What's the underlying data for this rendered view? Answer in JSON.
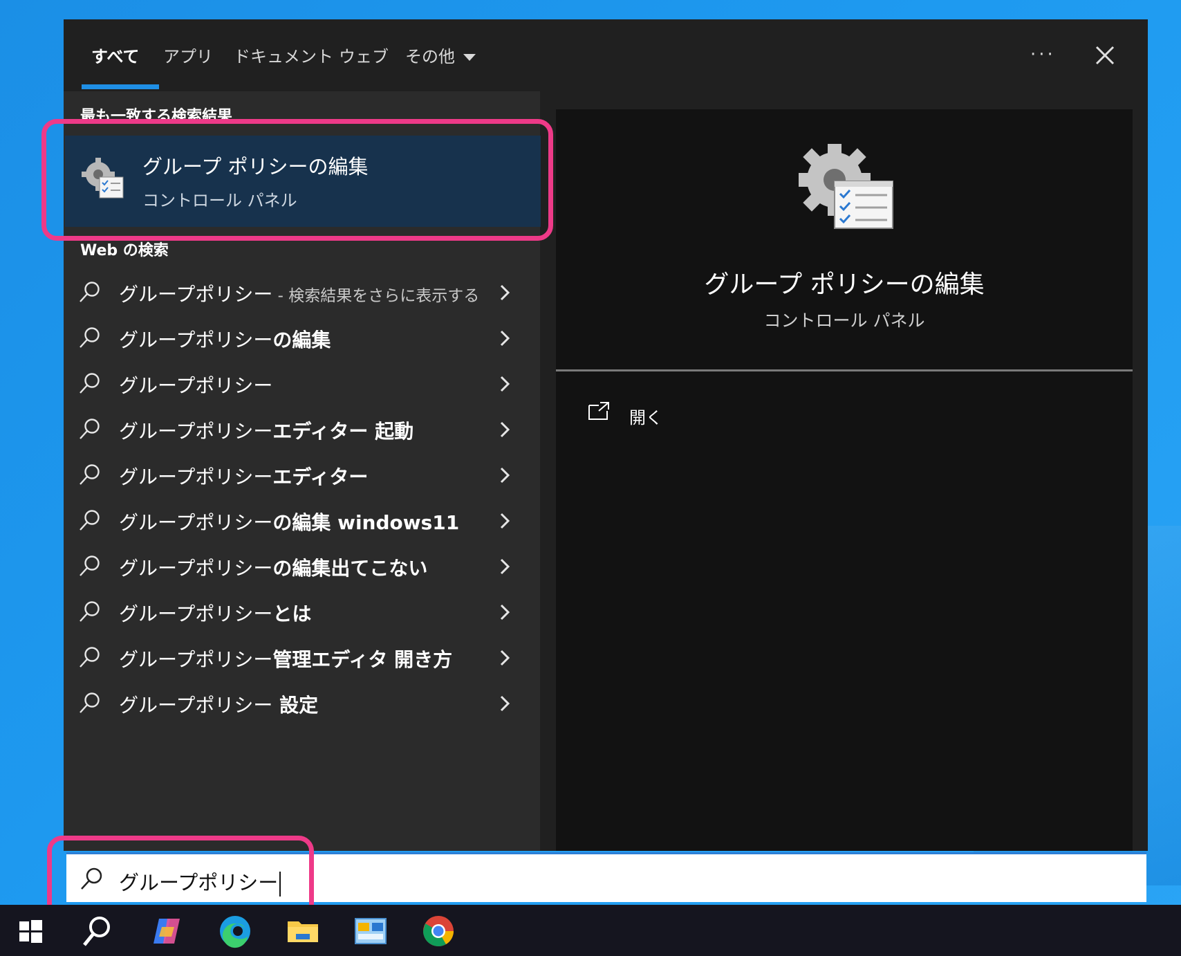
{
  "tabs": [
    {
      "label": "すべて",
      "active": true
    },
    {
      "label": "アプリ"
    },
    {
      "label": "ドキュメント"
    },
    {
      "label": "ウェブ"
    },
    {
      "label": "その他"
    }
  ],
  "top_icons": {
    "more": "more-options-icon",
    "close": "close-icon"
  },
  "best_match": {
    "section_label": "最も一致する検索結果",
    "title": "グループ ポリシーの編集",
    "subtitle": "コントロール パネル",
    "icon": "group-policy-icon"
  },
  "web_search": {
    "section_label": "Web の検索",
    "items": [
      {
        "plain": "グループポリシー",
        "bold": "",
        "sub": " - 検索結果をさらに表示する"
      },
      {
        "plain": "グループポリシー",
        "bold": "の編集",
        "sub": ""
      },
      {
        "plain": "グループポリシー",
        "bold": "",
        "sub": ""
      },
      {
        "plain": "グループポリシー",
        "bold": "エディター 起動",
        "sub": ""
      },
      {
        "plain": "グループポリシー",
        "bold": "エディター",
        "sub": ""
      },
      {
        "plain": "グループポリシー",
        "bold": "の編集 windows11",
        "sub": ""
      },
      {
        "plain": "グループポリシー",
        "bold": "の編集出てこない",
        "sub": ""
      },
      {
        "plain": "グループポリシー",
        "bold": "とは",
        "sub": ""
      },
      {
        "plain": "グループポリシー",
        "bold": "管理エディタ 開き方",
        "sub": ""
      },
      {
        "plain": "グループポリシー",
        "bold": " 設定",
        "sub": ""
      }
    ]
  },
  "preview": {
    "title": "グループ ポリシーの編集",
    "subtitle": "コントロール パネル",
    "actions": [
      {
        "label": "開く",
        "icon": "open-external-icon"
      }
    ]
  },
  "search_box": {
    "query": "グループポリシー"
  },
  "taskbar": {
    "items": [
      "windows-start-icon",
      "search-icon",
      "copilot-icon",
      "edge-icon",
      "file-explorer-icon",
      "control-panel-icon",
      "chrome-icon"
    ]
  },
  "colors": {
    "accent": "#1f8fe5",
    "highlight": "#ee3a88",
    "selected": "#17324d"
  }
}
